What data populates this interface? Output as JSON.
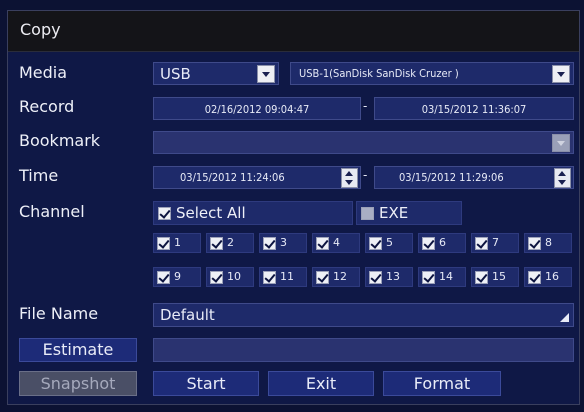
{
  "title": "Copy",
  "labels": {
    "media": "Media",
    "record": "Record",
    "bookmark": "Bookmark",
    "time": "Time",
    "channel": "Channel",
    "file_name": "File Name"
  },
  "media": {
    "type": "USB",
    "device": "USB-1(SanDisk SanDisk Cruzer   )"
  },
  "record": {
    "start": "02/16/2012 09:04:47",
    "end": "03/15/2012 11:36:07",
    "separator": "-"
  },
  "bookmark": {
    "value": ""
  },
  "time": {
    "start": "03/15/2012 11:24:06",
    "end": "03/15/2012 11:29:06",
    "separator": "-"
  },
  "channel": {
    "select_all_label": "Select All",
    "select_all_checked": true,
    "exe_label": "EXE",
    "exe_checked": false,
    "channels": [
      "1",
      "2",
      "3",
      "4",
      "5",
      "6",
      "7",
      "8",
      "9",
      "10",
      "11",
      "12",
      "13",
      "14",
      "15",
      "16"
    ]
  },
  "file_name": {
    "value": "Default"
  },
  "estimate": {
    "label": "Estimate",
    "value": ""
  },
  "buttons": {
    "snapshot": "Snapshot",
    "start": "Start",
    "exit": "Exit",
    "format": "Format"
  },
  "colors": {
    "background": "#0f1846",
    "field": "#1e2a6a",
    "titlebar": "#141418",
    "text": "#eef0f8"
  }
}
